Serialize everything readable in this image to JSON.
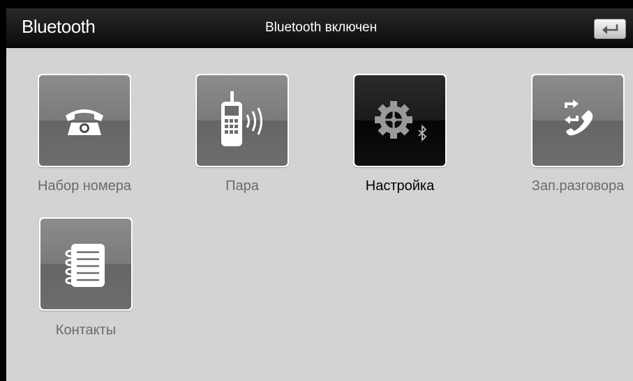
{
  "header": {
    "title": "Bluetooth",
    "status": "Bluetooth включен",
    "back_icon": "back-arrow-icon"
  },
  "menu": {
    "items": [
      {
        "label": "Набор номера",
        "icon": "phone-dial-icon",
        "active": false
      },
      {
        "label": "Пара",
        "icon": "mobile-pairing-icon",
        "active": false
      },
      {
        "label": "Настройка",
        "icon": "settings-gear-bluetooth-icon",
        "active": true
      },
      {
        "label": "Зап.разговора",
        "icon": "call-log-icon",
        "active": false
      },
      {
        "label": "Контакты",
        "icon": "contacts-notebook-icon",
        "active": false
      }
    ]
  },
  "colors": {
    "header_bg": "#111111",
    "content_bg": "#d3d3d3",
    "tile_inactive": "#7a7a7a",
    "tile_active": "#111111",
    "label_inactive": "#6a6a6a",
    "label_active": "#000000"
  }
}
